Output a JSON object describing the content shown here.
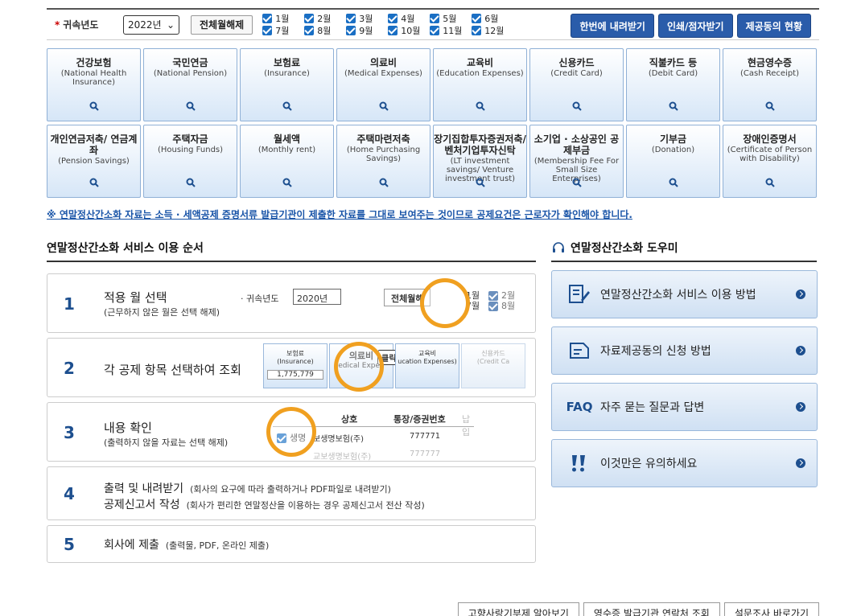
{
  "filter": {
    "label": "귀속년도",
    "required_mark": "*",
    "year": "2022년",
    "clear_label": "전체월해제",
    "months": [
      "1월",
      "2월",
      "3월",
      "4월",
      "5월",
      "6월",
      "7월",
      "8월",
      "9월",
      "10월",
      "11월",
      "12월"
    ],
    "buttons": [
      "한번에 내려받기",
      "인쇄/점자받기",
      "제공동의 현황"
    ]
  },
  "categories": [
    {
      "ko": "건강보험",
      "en": "(National Health Insurance)"
    },
    {
      "ko": "국민연금",
      "en": "(National Pension)"
    },
    {
      "ko": "보험료",
      "en": "(Insurance)"
    },
    {
      "ko": "의료비",
      "en": "(Medical Expenses)"
    },
    {
      "ko": "교육비",
      "en": "(Education Expenses)"
    },
    {
      "ko": "신용카드",
      "en": "(Credit Card)"
    },
    {
      "ko": "직불카드 등",
      "en": "(Debit Card)"
    },
    {
      "ko": "현금영수증",
      "en": "(Cash Receipt)"
    },
    {
      "ko": "개인연금저축/ 연금계좌",
      "en": "(Pension Savings)"
    },
    {
      "ko": "주택자금",
      "en": "(Housing Funds)"
    },
    {
      "ko": "월세액",
      "en": "(Monthly rent)"
    },
    {
      "ko": "주택마련저축",
      "en": "(Home Purchasing Savings)"
    },
    {
      "ko": "장기집합투자증권저축/ 벤처기업투자신탁",
      "en": "(LT investment savings/ Venture investment trust)"
    },
    {
      "ko": "소기업 · 소상공인 공제부금",
      "en": "(Membership Fee For Small Size Enterprises)"
    },
    {
      "ko": "기부금",
      "en": "(Donation)"
    },
    {
      "ko": "장애인증명서",
      "en": "(Certificate of Person with Disability)"
    }
  ],
  "notice": "※ 연말정산간소화 자료는 소득 · 세액공제 증명서류 발급기관이 제출한 자료를 그대로 보여주는 것이므로 공제요건은 근로자가 확인해야 합니다.",
  "order": {
    "title": "연말정산간소화 서비스 이용 순서",
    "steps": [
      {
        "num": "1",
        "title": "적용 월 선택",
        "sub": "(근무하지 않은 월은 선택 해제)"
      },
      {
        "num": "2",
        "title": "각 공제 항목 선택하여 조회",
        "sub": ""
      },
      {
        "num": "3",
        "title": "내용 확인",
        "sub": "(출력하지 않을 자료는 선택 해제)"
      },
      {
        "num": "4",
        "title": "출력 및 내려받기",
        "title2": "공제신고서 작성",
        "note1": "(회사의 요구에 따라 출력하거나 PDF파일로 내려받기)",
        "note2": "(회사가 편리한 연말정산을 이용하는 경우 공제신고서 전산 작성)"
      },
      {
        "num": "5",
        "title": "회사에 제출",
        "note1": "(출력물, PDF, 온라인 제출)"
      }
    ],
    "demo1": {
      "label": "귀속년도",
      "year": "2020년",
      "clear": "전체월해",
      "m1": "1월",
      "m7": "7월",
      "m2": "2월",
      "m8": "8월"
    },
    "demo2": {
      "c1": "보험료",
      "c1en": "(Insurance)",
      "amount": "1,775,779",
      "c2": "의료비",
      "c2en": "edical Expen",
      "click": "클릭!",
      "c3": "교육비",
      "c3en": "ucation Expenses)",
      "c4": "신용카드",
      "c4en": "(Credit Ca"
    },
    "demo3": {
      "h1": "상호",
      "h2": "통장/증권번호",
      "h3": "납입",
      "r1a": "생명",
      "r1b": "보생명보험(주)",
      "r1c": "777771",
      "r2b": "교보생명보험(주)",
      "r2c": "777777"
    }
  },
  "helper": {
    "title": "연말정산간소화 도우미",
    "items": [
      {
        "icon": "pencil-doc-icon",
        "label": "연말정산간소화 서비스 이용 방법"
      },
      {
        "icon": "document-icon",
        "label": "자료제공동의 신청 방법"
      },
      {
        "icon": "faq-icon",
        "label": "자주 묻는 질문과 답변",
        "icon_text": "FAQ"
      },
      {
        "icon": "exclamation-icon",
        "label": "이것만은 유의하세요"
      }
    ]
  },
  "bottom_buttons": [
    "고향사랑기부제 알아보기",
    "영수증 발급기관 연락처 조회",
    "설문조사 바로가기"
  ],
  "colors": {
    "accent": "#1d4f8f",
    "button": "#2a5caa",
    "highlight": "#f0a020"
  }
}
